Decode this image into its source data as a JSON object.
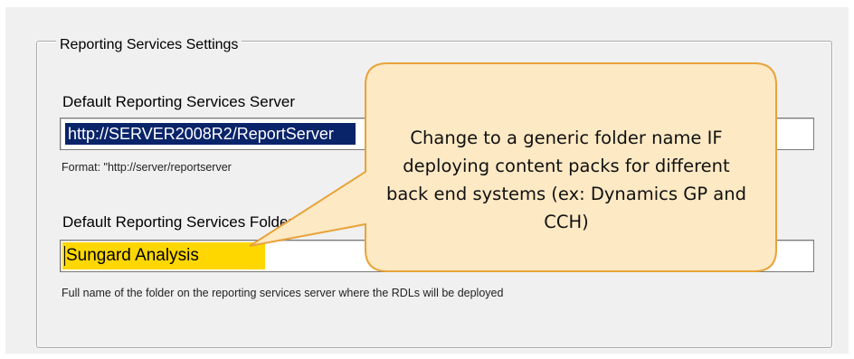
{
  "group": {
    "title": "Reporting Services Settings"
  },
  "server": {
    "label": "Default Reporting Services Server",
    "value": "http://SERVER2008R2/ReportServer",
    "format_hint": "Format: \"http://server/reportserver"
  },
  "folder": {
    "label": "Default Reporting Services Folder",
    "value": "Sungard Analysis",
    "hint": "Full name of the folder on the reporting services server where the RDLs will be deployed"
  },
  "callout": {
    "text": "Change to a generic folder name IF deploying content packs for different back end systems (ex: Dynamics GP and CCH)"
  },
  "colors": {
    "dialog_bg": "#f0f0f0",
    "selection": "#0a246a",
    "highlight": "#ffd700",
    "callout_fill": "#fde9c4",
    "callout_border": "#e8a33a"
  }
}
